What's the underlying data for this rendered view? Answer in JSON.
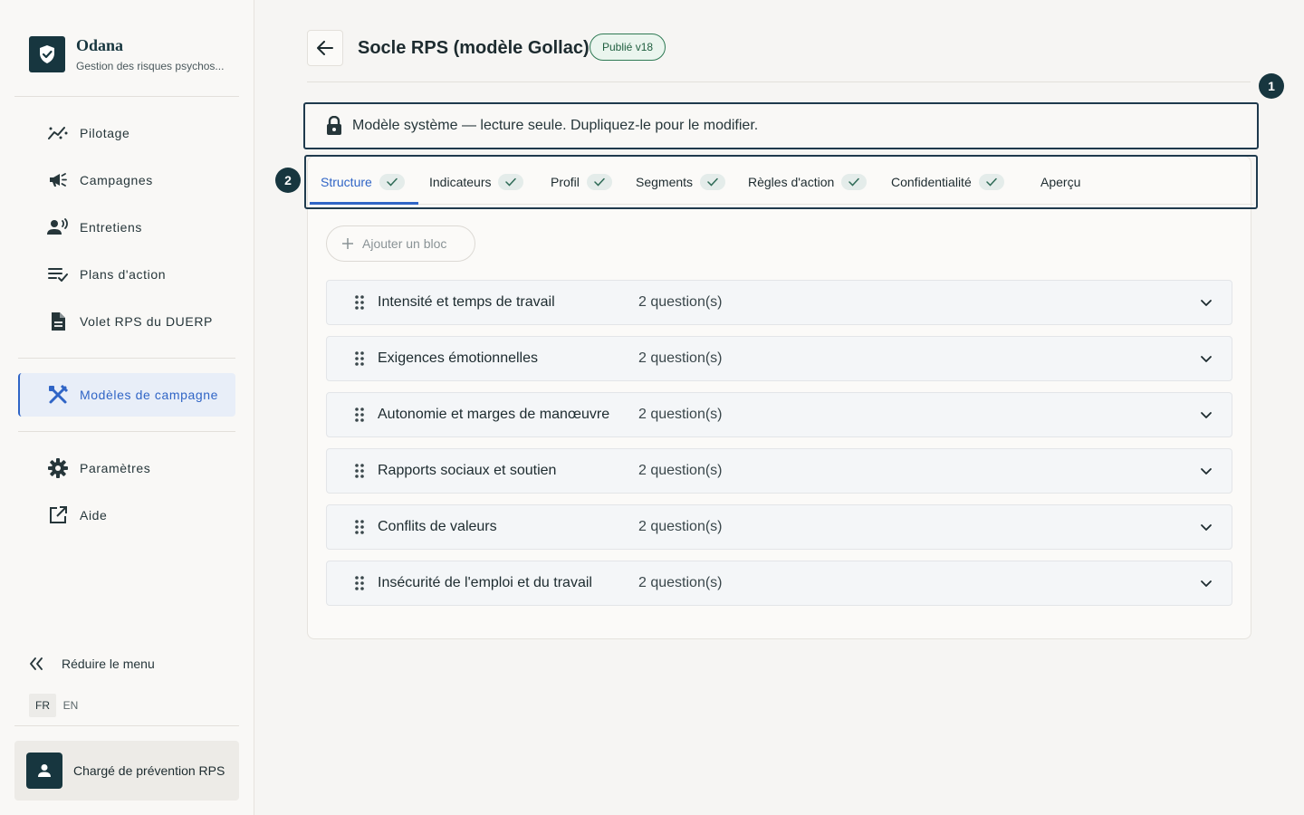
{
  "brand": {
    "name": "Odana",
    "subtitle": "Gestion des risques psychos..."
  },
  "nav": {
    "items": [
      {
        "label": "Pilotage",
        "icon": "trend-icon"
      },
      {
        "label": "Campagnes",
        "icon": "megaphone-icon"
      },
      {
        "label": "Entretiens",
        "icon": "person-voice-icon"
      },
      {
        "label": "Plans d'action",
        "icon": "list-check-icon"
      },
      {
        "label": "Volet RPS du DUERP",
        "icon": "document-icon"
      }
    ],
    "active": {
      "label": "Modèles de campagne",
      "icon": "design-tools-icon"
    },
    "settings": {
      "label": "Paramètres",
      "icon": "gear-icon"
    },
    "help": {
      "label": "Aide",
      "icon": "external-link-icon"
    }
  },
  "collapse_label": "Réduire le menu",
  "languages": {
    "fr": "FR",
    "en": "EN",
    "selected": "FR"
  },
  "user": {
    "role": "Chargé de prévention RPS"
  },
  "header": {
    "title": "Socle RPS (modèle Gollac)",
    "badge": "Publié v18"
  },
  "markers": {
    "one": "1",
    "two": "2"
  },
  "notice": "Modèle système — lecture seule. Dupliquez-le pour le modifier.",
  "tabs": [
    {
      "label": "Structure",
      "checked": true,
      "active": true
    },
    {
      "label": "Indicateurs",
      "checked": true
    },
    {
      "label": "Profil",
      "checked": true
    },
    {
      "label": "Segments",
      "checked": true
    },
    {
      "label": "Règles d'action",
      "checked": true
    },
    {
      "label": "Confidentialité",
      "checked": true
    },
    {
      "label": "Aperçu",
      "checked": false
    }
  ],
  "add_block_label": "Ajouter un bloc",
  "blocks": [
    {
      "title": "Intensité et temps de travail",
      "count": "2 question(s)"
    },
    {
      "title": "Exigences émotionnelles",
      "count": "2 question(s)"
    },
    {
      "title": "Autonomie et marges de manœuvre",
      "count": "2 question(s)"
    },
    {
      "title": "Rapports sociaux et soutien",
      "count": "2 question(s)"
    },
    {
      "title": "Conflits de valeurs",
      "count": "2 question(s)"
    },
    {
      "title": "Insécurité de l'emploi et du travail",
      "count": "2 question(s)"
    }
  ],
  "colors": {
    "primary_dark": "#17363f",
    "accent_blue": "#3065c6",
    "badge_green": "#2f7a54"
  }
}
